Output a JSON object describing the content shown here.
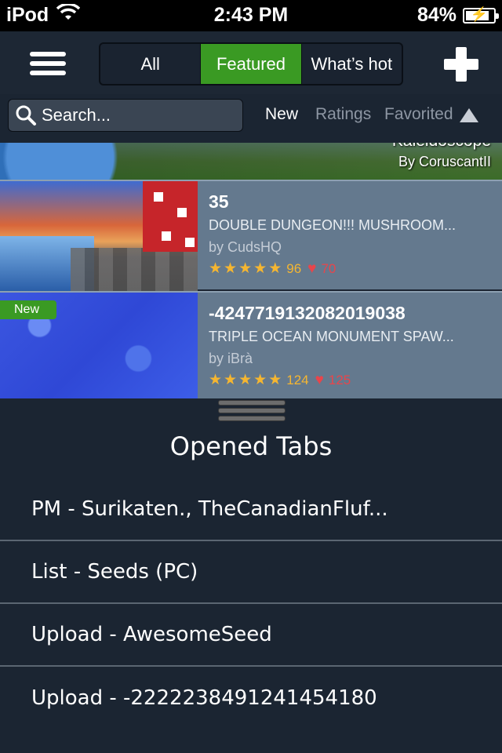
{
  "status_bar": {
    "carrier": "iPod",
    "time": "2:43 PM",
    "battery": "84%",
    "battery_level": 0.84,
    "icons": [
      "wifi-icon",
      "battery-charging-icon"
    ]
  },
  "nav": {
    "tabs": [
      {
        "label": "All",
        "active": false
      },
      {
        "label": "Featured",
        "active": true
      },
      {
        "label": "What’s hot",
        "active": false
      }
    ],
    "menu_icon": "hamburger-icon",
    "add_icon": "plus-icon",
    "accent_color": "#3a9a23"
  },
  "search": {
    "placeholder": "Search...",
    "icon": "search-icon"
  },
  "sort": {
    "options": [
      {
        "label": "New",
        "active": true
      },
      {
        "label": "Ratings",
        "active": false
      },
      {
        "label": "Favorited",
        "active": false
      }
    ],
    "direction_icon": "triangle-up-icon"
  },
  "list": {
    "partial_item": {
      "title": "Kaleidoscope",
      "author": "By CoruscantII"
    },
    "items": [
      {
        "title": "35",
        "subtitle": "DOUBLE DUNGEON!!! MUSHROOM...",
        "author": "by CudsHQ",
        "stars": 5,
        "ratings": "96",
        "favorites": "70",
        "badge": ""
      },
      {
        "title": "-4247719132082019038",
        "subtitle": "TRIPLE OCEAN MONUMENT SPAW...",
        "author": "by iBrà",
        "stars": 5,
        "ratings": "124",
        "favorites": "125",
        "badge": "New"
      }
    ]
  },
  "drawer": {
    "title": "Opened Tabs",
    "tabs": [
      "PM - Surikaten., TheCanadianFluf...",
      "List - Seeds (PC)",
      "Upload - AwesomeSeed",
      "Upload - -2222238491241454180"
    ]
  }
}
